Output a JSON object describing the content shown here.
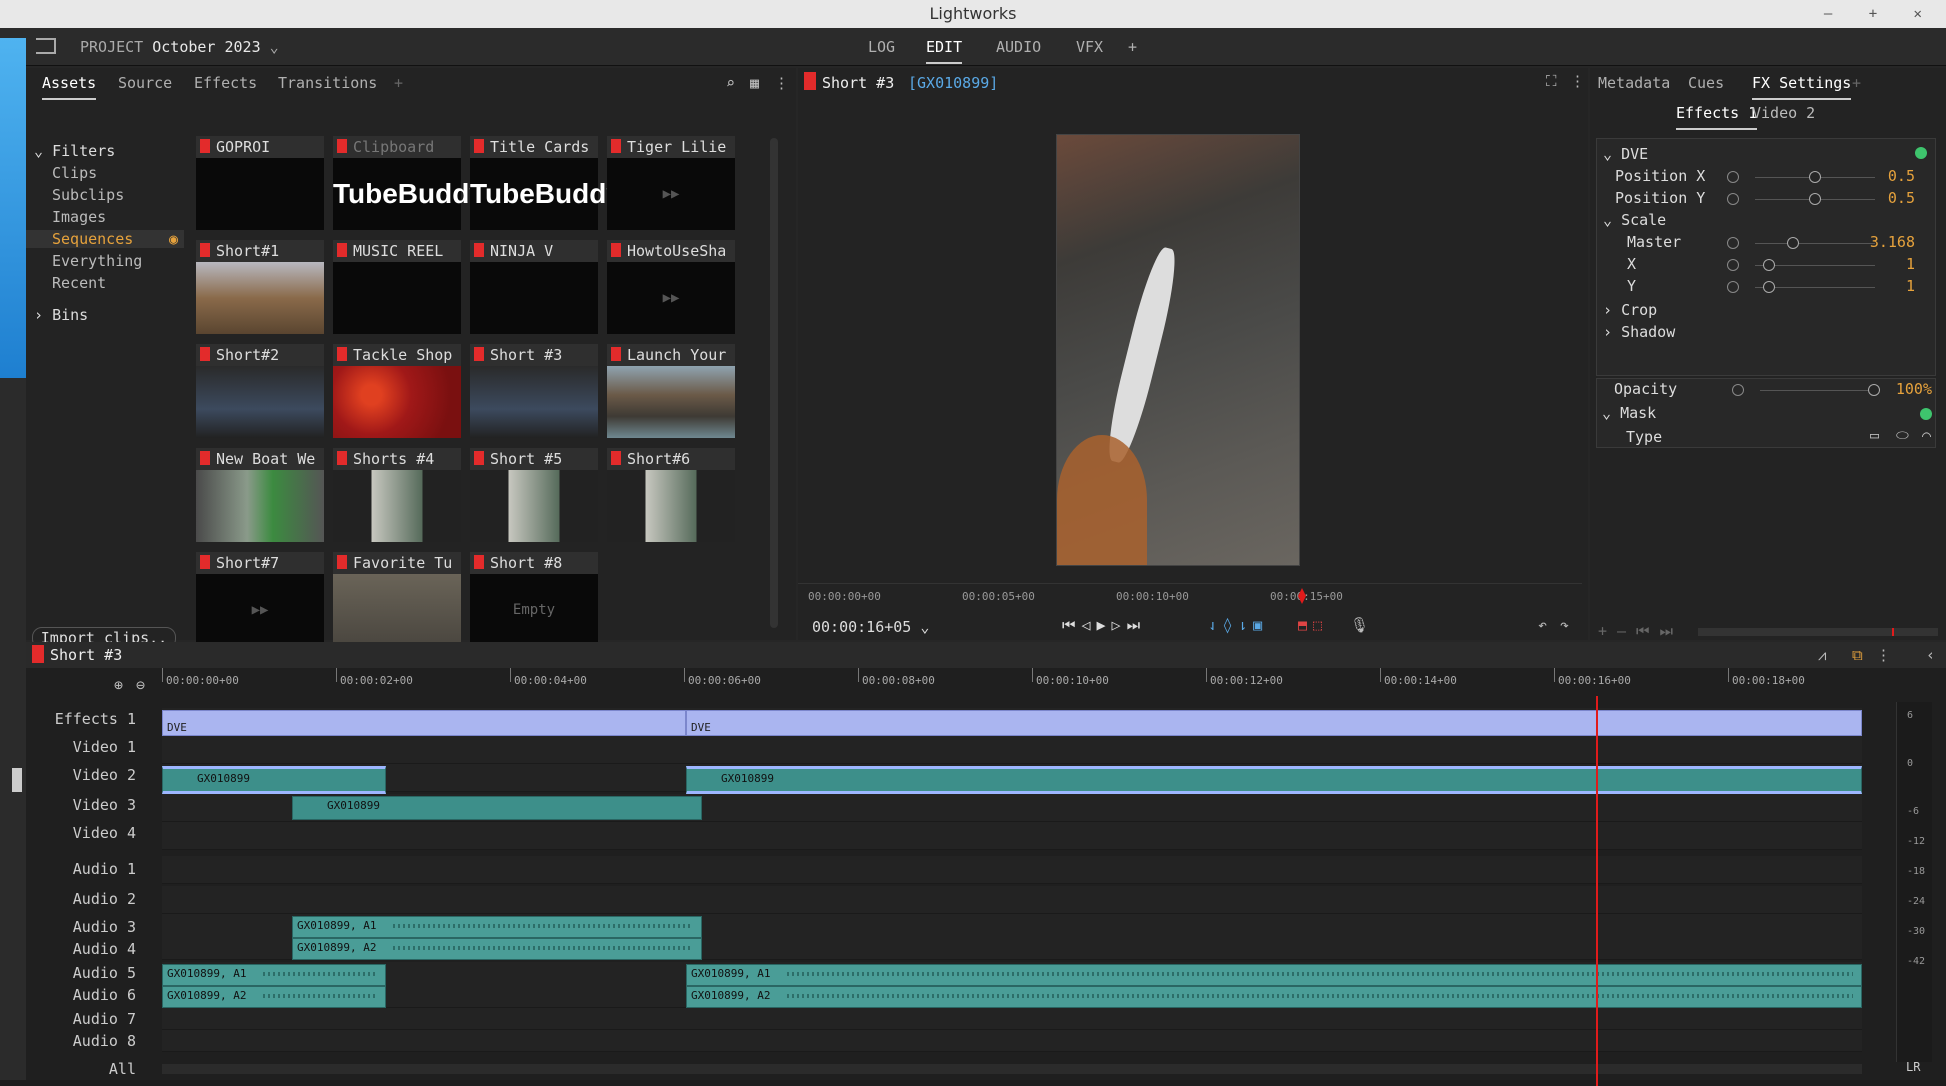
{
  "window": {
    "title": "Lightworks"
  },
  "topbar": {
    "project_label": "PROJECT",
    "project_name": "October 2023",
    "rooms": [
      "LOG",
      "EDIT",
      "AUDIO",
      "VFX",
      "+"
    ],
    "active_room": "EDIT"
  },
  "assets": {
    "tabs": [
      "Assets",
      "Source",
      "Effects",
      "Transitions",
      "+"
    ],
    "filters": {
      "heading": "Filters",
      "items": [
        "Clips",
        "Subclips",
        "Images",
        "Sequences",
        "Everything",
        "Recent"
      ],
      "selected": "Sequences",
      "bins": "Bins"
    },
    "grid": [
      {
        "name": "GOPROI",
        "thumb": "black"
      },
      {
        "name": "Clipboard",
        "thumb": "tubebuddy",
        "dim": true
      },
      {
        "name": "Title Cards",
        "thumb": "tubebuddy"
      },
      {
        "name": "Tiger Lilie",
        "thumb": "play"
      },
      {
        "name": "Short#1",
        "thumb": "food"
      },
      {
        "name": "MUSIC REEL",
        "thumb": "black"
      },
      {
        "name": "NINJA V",
        "thumb": "black"
      },
      {
        "name": "HowtoUseSha",
        "thumb": "play"
      },
      {
        "name": "Short#2",
        "thumb": "dark"
      },
      {
        "name": "Tackle Shop",
        "thumb": "red"
      },
      {
        "name": "Short #3",
        "thumb": "dark"
      },
      {
        "name": "Launch Your",
        "thumb": "man"
      },
      {
        "name": "New Boat We",
        "thumb": "boat"
      },
      {
        "name": "Shorts #4",
        "thumb": "portrait"
      },
      {
        "name": "Short #5",
        "thumb": "portrait"
      },
      {
        "name": "Short#6",
        "thumb": "portrait"
      },
      {
        "name": "Short#7",
        "thumb": "play"
      },
      {
        "name": "Favorite Tu",
        "thumb": "grey"
      },
      {
        "name": "Short #8",
        "thumb": "empty"
      }
    ],
    "empty_label": "Empty",
    "tubebuddy_text": "TubeBuddy",
    "import_button": "Import clips.."
  },
  "viewer": {
    "title": "Short #3",
    "source": "[GX010899]",
    "ruler_ticks": [
      "00:00:00+00",
      "00:00:05+00",
      "00:00:10+00",
      "00:00:15+00"
    ],
    "timecode": "00:00:16+05"
  },
  "fx_panel": {
    "tabs": [
      "Metadata",
      "Cues",
      "FX Settings",
      "+"
    ],
    "subtabs": [
      "Effects 1",
      "Video 2"
    ],
    "dve": "DVE",
    "position_x_label": "Position X",
    "position_x": "0.5",
    "position_y_label": "Position Y",
    "position_y": "0.5",
    "scale_label": "Scale",
    "master_label": "Master",
    "master": "3.168",
    "x_label": "X",
    "x": "1",
    "y_label": "Y",
    "y": "1",
    "crop_label": "Crop",
    "shadow_label": "Shadow",
    "opacity_label": "Opacity",
    "opacity": "100%",
    "mask_label": "Mask",
    "type_label": "Type"
  },
  "timeline": {
    "title": "Short #3",
    "ticks": [
      "00:00:00+00",
      "00:00:02+00",
      "00:00:04+00",
      "00:00:06+00",
      "00:00:08+00",
      "00:00:10+00",
      "00:00:12+00",
      "00:00:14+00",
      "00:00:16+00",
      "00:00:18+00"
    ],
    "tracks": [
      "Effects 1",
      "Video 1",
      "Video 2",
      "Video 3",
      "Video 4",
      "Audio 1",
      "Audio 2",
      "Audio 3",
      "Audio 4",
      "Audio 5",
      "Audio 6",
      "Audio 7",
      "Audio 8",
      "All"
    ],
    "dve_label": "DVE",
    "clip_name": "GX010899",
    "audio_a1": "GX010899, A1",
    "audio_a2": "GX010899, A2",
    "meter_ticks": [
      "6",
      "0",
      "-6",
      "-12",
      "-18",
      "-24",
      "-30",
      "-42"
    ],
    "meter_label": "LR"
  },
  "colors": {
    "accent": "#e6a23c",
    "playhead": "#e01b1b",
    "clip": "#3d8f8a",
    "fx_clip": "#aab5f0"
  }
}
